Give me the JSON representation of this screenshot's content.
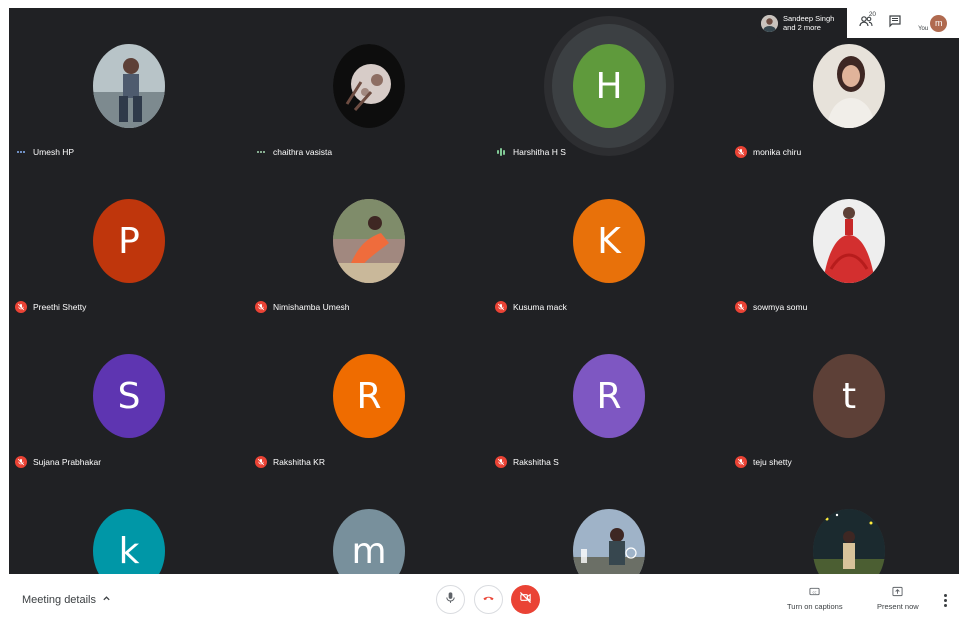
{
  "colors": {
    "grid_background": "#202124",
    "mute_red": "#ea4335",
    "bar_background": "#ffffff"
  },
  "topbar": {
    "speaker_name": "Sandeep Singh",
    "speaker_more": "and 2 more",
    "participants_count": "20",
    "you_label": "You",
    "you_initial": "m"
  },
  "participants": [
    {
      "name": "Umesh HP",
      "status": "speaking-dots",
      "avatar_type": "photo",
      "initial": "",
      "color": "#5b6f7a"
    },
    {
      "name": "chaithra vasista",
      "status": "speaking-dots",
      "avatar_type": "photo",
      "initial": "",
      "color": "#111111"
    },
    {
      "name": "Harshitha H S",
      "status": "speaking-bars",
      "avatar_type": "letter",
      "initial": "H",
      "color": "#5f9a3c"
    },
    {
      "name": "monika chiru",
      "status": "muted",
      "avatar_type": "photo",
      "initial": "",
      "color": "#d9d4cc"
    },
    {
      "name": "Preethi Shetty",
      "status": "muted",
      "avatar_type": "letter",
      "initial": "P",
      "color": "#bf360c"
    },
    {
      "name": "Nimishamba Umesh",
      "status": "muted",
      "avatar_type": "photo",
      "initial": "",
      "color": "#8b7a5e"
    },
    {
      "name": "Kusuma mack",
      "status": "muted",
      "avatar_type": "letter",
      "initial": "K",
      "color": "#e8710a"
    },
    {
      "name": "sowmya somu",
      "status": "muted",
      "avatar_type": "photo",
      "initial": "",
      "color": "#e8e8e8"
    },
    {
      "name": "Sujana Prabhakar",
      "status": "muted",
      "avatar_type": "letter",
      "initial": "S",
      "color": "#5e35b1"
    },
    {
      "name": "Rakshitha KR",
      "status": "muted",
      "avatar_type": "letter",
      "initial": "R",
      "color": "#ef6c00"
    },
    {
      "name": "Rakshitha S",
      "status": "muted",
      "avatar_type": "letter",
      "initial": "R",
      "color": "#7e57c2"
    },
    {
      "name": "teju shetty",
      "status": "muted",
      "avatar_type": "letter",
      "initial": "t",
      "color": "#5d4037"
    },
    {
      "name": "",
      "status": "none",
      "avatar_type": "letter",
      "initial": "k",
      "color": "#0097a7"
    },
    {
      "name": "",
      "status": "none",
      "avatar_type": "letter",
      "initial": "m",
      "color": "#78909c"
    },
    {
      "name": "",
      "status": "none",
      "avatar_type": "photo",
      "initial": "",
      "color": "#8fa6b8"
    },
    {
      "name": "",
      "status": "none",
      "avatar_type": "photo",
      "initial": "",
      "color": "#5a6b3a"
    }
  ],
  "bottombar": {
    "meeting_details": "Meeting details",
    "captions_label": "Turn on captions",
    "present_label": "Present now"
  }
}
